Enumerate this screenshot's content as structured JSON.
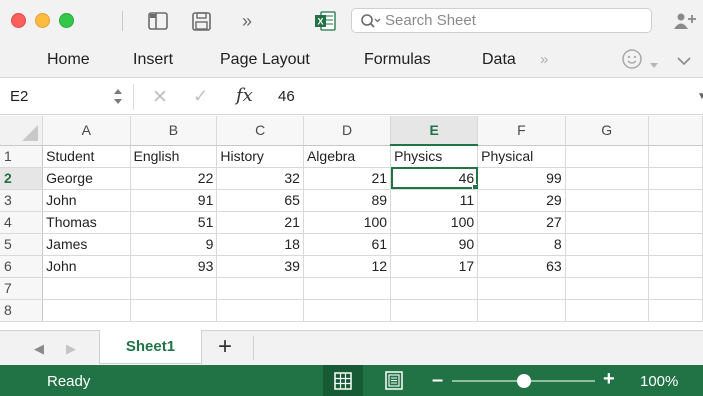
{
  "search": {
    "placeholder": "Search Sheet"
  },
  "ribbon": {
    "tabs": [
      "Home",
      "Insert",
      "Page Layout",
      "Formulas",
      "Data"
    ]
  },
  "formula_bar": {
    "name_box": "E2",
    "value": "46"
  },
  "sheet": {
    "columns": [
      "A",
      "B",
      "C",
      "D",
      "E",
      "F",
      "G"
    ],
    "row_numbers": [
      "1",
      "2",
      "3",
      "4",
      "5",
      "6",
      "7",
      "8"
    ],
    "header": [
      "Student",
      "English",
      "History",
      "Algebra",
      "Physics",
      "Physical"
    ],
    "rows": [
      [
        "George",
        "22",
        "32",
        "21",
        "46",
        "99"
      ],
      [
        "John",
        "91",
        "65",
        "89",
        "11",
        "29"
      ],
      [
        "Thomas",
        "51",
        "21",
        "100",
        "100",
        "27"
      ],
      [
        "James",
        "9",
        "18",
        "61",
        "90",
        "8"
      ],
      [
        "John",
        "93",
        "39",
        "12",
        "17",
        "63"
      ]
    ],
    "active_cell": "E2",
    "active_column": "E",
    "active_row": "2"
  },
  "sheet_tabs": {
    "tabs": [
      "Sheet1"
    ],
    "add_label": "+"
  },
  "status": {
    "ready": "Ready",
    "zoom": "100%",
    "zoom_fraction": 0.5
  },
  "colors": {
    "accent": "#217346",
    "selection": "#217346"
  },
  "icons": {
    "toolbar": [
      "sidebar-icon",
      "save-icon",
      "more-chevron-icon",
      "excel-file-icon"
    ],
    "share": "share-people-icon",
    "feedback": "smiley-icon",
    "status": [
      "normal-view-icon",
      "page-layout-view-icon"
    ]
  }
}
